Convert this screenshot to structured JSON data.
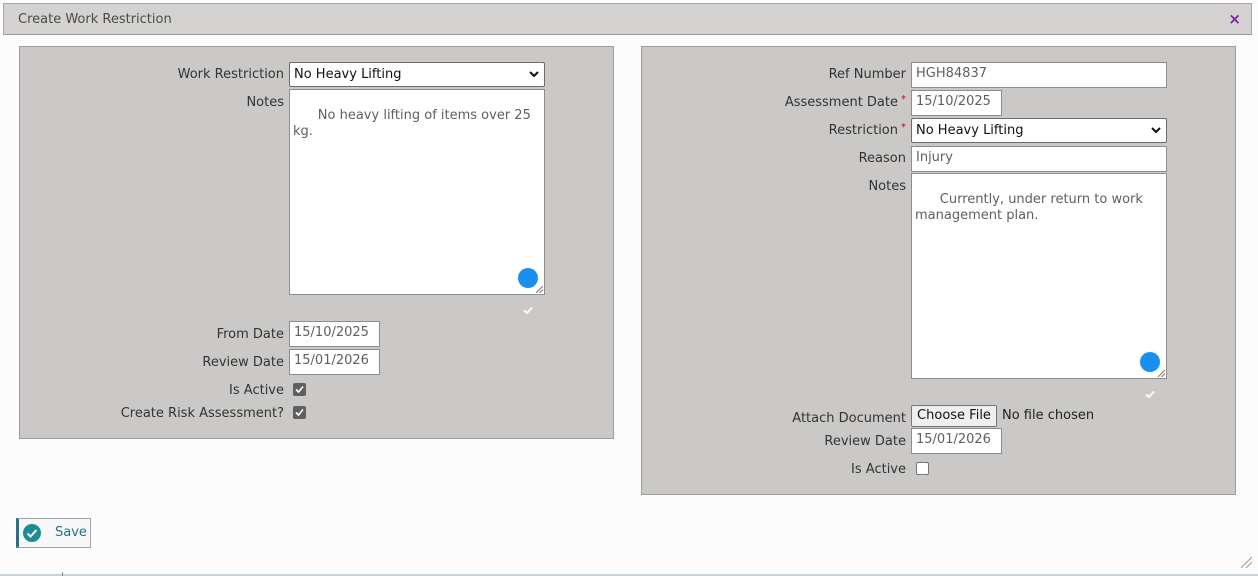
{
  "dialog": {
    "title": "Create Work Restriction",
    "close_glyph": "×"
  },
  "left": {
    "work_restriction_label": "Work Restriction",
    "work_restriction_value": "No Heavy Lifting",
    "notes_label": "Notes",
    "notes_value": "No heavy lifting of items over 25 kg.",
    "from_date_label": "From Date",
    "from_date_value": "15/10/2025",
    "review_date_label": "Review Date",
    "review_date_value": "15/01/2026",
    "is_active_label": "Is Active",
    "is_active_checked": true,
    "create_risk_label": "Create Risk Assessment?",
    "create_risk_checked": true
  },
  "right": {
    "ref_number_label": "Ref Number",
    "ref_number_value": "HGH84837",
    "assessment_date_label": "Assessment Date",
    "assessment_date_value": "15/10/2025",
    "restriction_label": "Restriction",
    "restriction_value": "No Heavy Lifting",
    "reason_label": "Reason",
    "reason_value": "Injury",
    "notes_label": "Notes",
    "notes_value": "Currently, under return to work\nmanagement plan.",
    "attach_document_label": "Attach Document",
    "choose_file_label": "Choose File",
    "file_status": "No file chosen",
    "review_date_label": "Review Date",
    "review_date_value": "15/01/2026",
    "is_active_label": "Is Active",
    "is_active_checked": false
  },
  "required_marker": "*",
  "footer": {
    "save_label": "Save"
  },
  "icons": {
    "close": "close-icon",
    "dropdown": "chevron-down-icon",
    "grammar": "grammar-check-icon",
    "check": "checkmark-icon",
    "save": "save-check-icon",
    "resize": "resize-grip-icon"
  },
  "colors": {
    "panel_bg": "#cac9c8",
    "title_bg": "#d4d3d1",
    "close": "#7a1fa6",
    "required": "#d0021b",
    "grammar_badge": "#1a8ff0",
    "save_accent": "#277186",
    "save_icon": "#1d8a97"
  }
}
